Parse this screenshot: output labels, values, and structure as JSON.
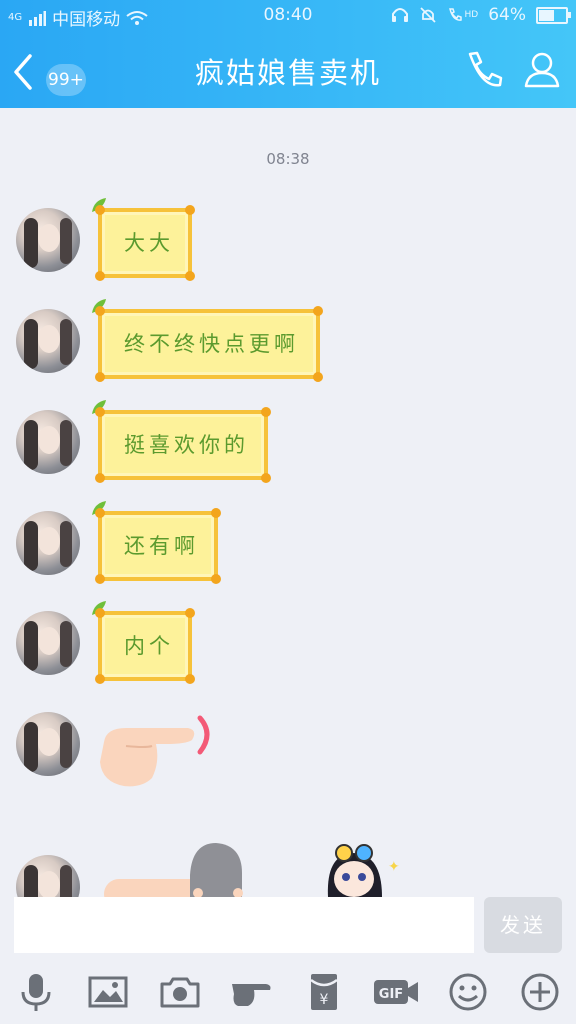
{
  "status_bar": {
    "carrier": "中国移动",
    "signal_label": "4G",
    "time": "08:40",
    "hd_label": "HD",
    "battery_text": "64%",
    "battery_level": 0.64
  },
  "header": {
    "unread_badge": "99+",
    "title": "疯姑娘售卖机",
    "icons": {
      "back": "chevron-left-icon",
      "call": "phone-icon",
      "profile": "person-icon"
    }
  },
  "chat": {
    "timestamp": "08:38",
    "messages": [
      {
        "type": "text",
        "text": "大大"
      },
      {
        "type": "text",
        "text": "终不终快点更啊"
      },
      {
        "type": "text",
        "text": "挺喜欢你的"
      },
      {
        "type": "text",
        "text": "还有啊"
      },
      {
        "type": "text",
        "text": "内个"
      },
      {
        "type": "sticker",
        "sticker": "pointing-hand-sticker"
      }
    ]
  },
  "composer": {
    "input_value": "",
    "send_label": "发送"
  },
  "toolbar": {
    "gif_label": "GIF",
    "items": [
      "microphone-icon",
      "image-icon",
      "camera-icon",
      "pointing-hand-icon",
      "red-packet-icon",
      "gif-icon",
      "emoji-icon",
      "plus-icon"
    ]
  },
  "colors": {
    "header_start": "#2aa7f4",
    "header_end": "#44c6f8",
    "background": "#eef0f6",
    "bubble_fill": "#fdf29a",
    "bubble_border": "#f6c23a",
    "bubble_text": "#5b9a2e"
  }
}
